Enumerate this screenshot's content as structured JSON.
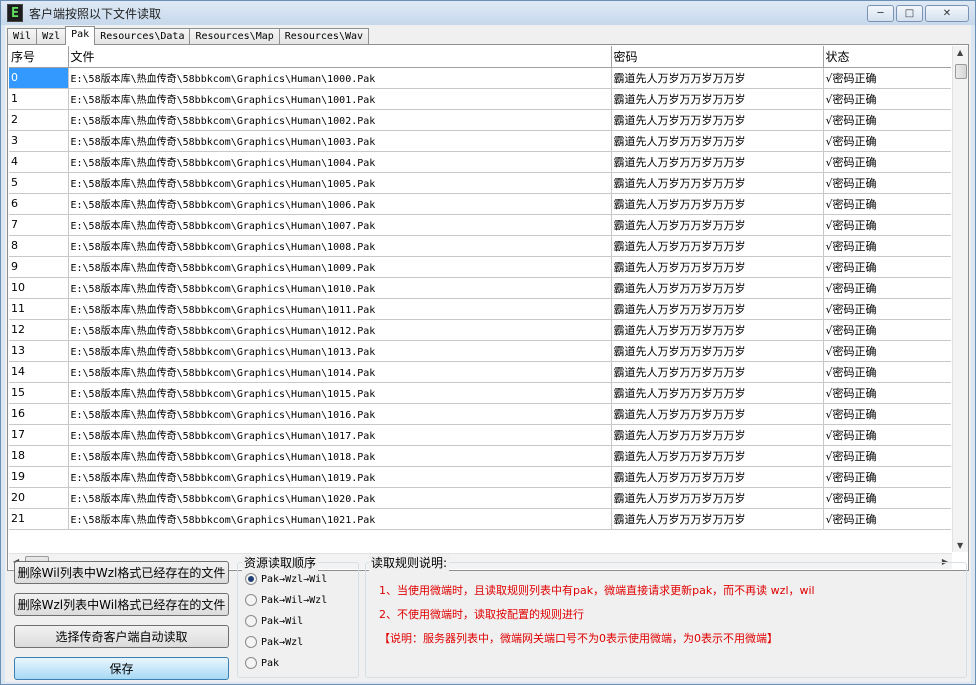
{
  "window": {
    "title": "客户端按照以下文件读取",
    "app_icon_glyph": "E"
  },
  "tabs": [
    {
      "label": "Wil",
      "active": false
    },
    {
      "label": "Wzl",
      "active": false
    },
    {
      "label": "Pak",
      "active": true
    },
    {
      "label": "Resources\\Data",
      "active": false
    },
    {
      "label": "Resources\\Map",
      "active": false
    },
    {
      "label": "Resources\\Wav",
      "active": false
    }
  ],
  "table": {
    "columns": [
      "序号",
      "文件",
      "密码",
      "状态"
    ],
    "rows": [
      [
        "0",
        "E:\\58版本库\\热血传奇\\58bbkcom\\Graphics\\Human\\1000.Pak",
        "霸道先人万岁万万岁万万岁",
        "√密码正确"
      ],
      [
        "1",
        "E:\\58版本库\\热血传奇\\58bbkcom\\Graphics\\Human\\1001.Pak",
        "霸道先人万岁万万岁万万岁",
        "√密码正确"
      ],
      [
        "2",
        "E:\\58版本库\\热血传奇\\58bbkcom\\Graphics\\Human\\1002.Pak",
        "霸道先人万岁万万岁万万岁",
        "√密码正确"
      ],
      [
        "3",
        "E:\\58版本库\\热血传奇\\58bbkcom\\Graphics\\Human\\1003.Pak",
        "霸道先人万岁万万岁万万岁",
        "√密码正确"
      ],
      [
        "4",
        "E:\\58版本库\\热血传奇\\58bbkcom\\Graphics\\Human\\1004.Pak",
        "霸道先人万岁万万岁万万岁",
        "√密码正确"
      ],
      [
        "5",
        "E:\\58版本库\\热血传奇\\58bbkcom\\Graphics\\Human\\1005.Pak",
        "霸道先人万岁万万岁万万岁",
        "√密码正确"
      ],
      [
        "6",
        "E:\\58版本库\\热血传奇\\58bbkcom\\Graphics\\Human\\1006.Pak",
        "霸道先人万岁万万岁万万岁",
        "√密码正确"
      ],
      [
        "7",
        "E:\\58版本库\\热血传奇\\58bbkcom\\Graphics\\Human\\1007.Pak",
        "霸道先人万岁万万岁万万岁",
        "√密码正确"
      ],
      [
        "8",
        "E:\\58版本库\\热血传奇\\58bbkcom\\Graphics\\Human\\1008.Pak",
        "霸道先人万岁万万岁万万岁",
        "√密码正确"
      ],
      [
        "9",
        "E:\\58版本库\\热血传奇\\58bbkcom\\Graphics\\Human\\1009.Pak",
        "霸道先人万岁万万岁万万岁",
        "√密码正确"
      ],
      [
        "10",
        "E:\\58版本库\\热血传奇\\58bbkcom\\Graphics\\Human\\1010.Pak",
        "霸道先人万岁万万岁万万岁",
        "√密码正确"
      ],
      [
        "11",
        "E:\\58版本库\\热血传奇\\58bbkcom\\Graphics\\Human\\1011.Pak",
        "霸道先人万岁万万岁万万岁",
        "√密码正确"
      ],
      [
        "12",
        "E:\\58版本库\\热血传奇\\58bbkcom\\Graphics\\Human\\1012.Pak",
        "霸道先人万岁万万岁万万岁",
        "√密码正确"
      ],
      [
        "13",
        "E:\\58版本库\\热血传奇\\58bbkcom\\Graphics\\Human\\1013.Pak",
        "霸道先人万岁万万岁万万岁",
        "√密码正确"
      ],
      [
        "14",
        "E:\\58版本库\\热血传奇\\58bbkcom\\Graphics\\Human\\1014.Pak",
        "霸道先人万岁万万岁万万岁",
        "√密码正确"
      ],
      [
        "15",
        "E:\\58版本库\\热血传奇\\58bbkcom\\Graphics\\Human\\1015.Pak",
        "霸道先人万岁万万岁万万岁",
        "√密码正确"
      ],
      [
        "16",
        "E:\\58版本库\\热血传奇\\58bbkcom\\Graphics\\Human\\1016.Pak",
        "霸道先人万岁万万岁万万岁",
        "√密码正确"
      ],
      [
        "17",
        "E:\\58版本库\\热血传奇\\58bbkcom\\Graphics\\Human\\1017.Pak",
        "霸道先人万岁万万岁万万岁",
        "√密码正确"
      ],
      [
        "18",
        "E:\\58版本库\\热血传奇\\58bbkcom\\Graphics\\Human\\1018.Pak",
        "霸道先人万岁万万岁万万岁",
        "√密码正确"
      ],
      [
        "19",
        "E:\\58版本库\\热血传奇\\58bbkcom\\Graphics\\Human\\1019.Pak",
        "霸道先人万岁万万岁万万岁",
        "√密码正确"
      ],
      [
        "20",
        "E:\\58版本库\\热血传奇\\58bbkcom\\Graphics\\Human\\1020.Pak",
        "霸道先人万岁万万岁万万岁",
        "√密码正确"
      ],
      [
        "21",
        "E:\\58版本库\\热血传奇\\58bbkcom\\Graphics\\Human\\1021.Pak",
        "霸道先人万岁万万岁万万岁",
        "√密码正确"
      ]
    ]
  },
  "buttons": {
    "delete_wil": "删除Wil列表中Wzl格式已经存在的文件",
    "delete_wzl": "删除Wzl列表中Wil格式已经存在的文件",
    "select_client": "选择传奇客户端自动读取",
    "save": "保存"
  },
  "read_order": {
    "title": "资源读取顺序",
    "options": [
      {
        "label": "Pak→Wzl→Wil",
        "checked": true
      },
      {
        "label": "Pak→Wil→Wzl",
        "checked": false
      },
      {
        "label": "Pak→Wil",
        "checked": false
      },
      {
        "label": "Pak→Wzl",
        "checked": false
      },
      {
        "label": "Pak",
        "checked": false
      }
    ]
  },
  "rules": {
    "title": "读取规则说明:",
    "lines": [
      "1、当使用微端时，且读取规则列表中有pak，微端直接请求更新pak，而不再读 wzl，wil",
      "2、不使用微端时，读取按配置的规则进行",
      "【说明：服务器列表中，微端网关端口号不为0表示使用微端，为0表示不用微端】"
    ],
    "color": "#e00000"
  },
  "colors": {
    "selection": "#3399ff",
    "primary_button": "#a7d9f5"
  }
}
